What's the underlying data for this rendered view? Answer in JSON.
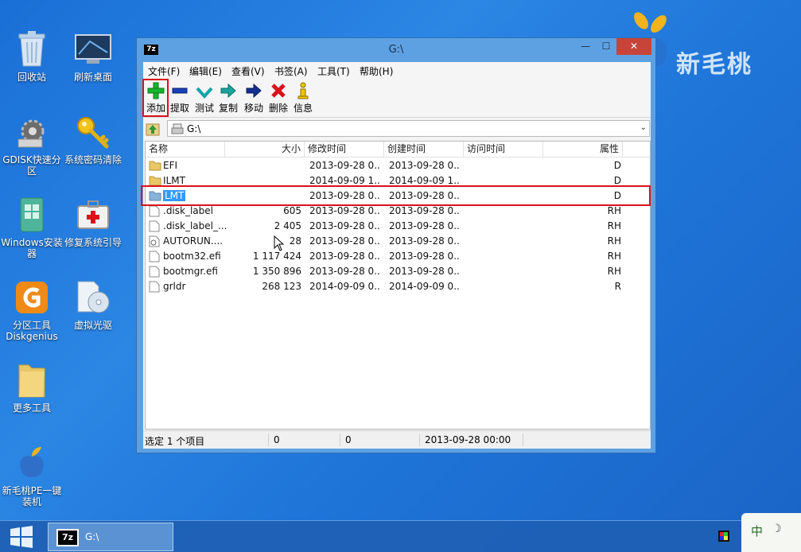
{
  "desktop": {
    "icons": [
      {
        "label": "回收站"
      },
      {
        "label": "刷新桌面"
      },
      {
        "label": "GDISK快速分区"
      },
      {
        "label": "系统密码清除"
      },
      {
        "label": "Windows安装器"
      },
      {
        "label": "修复系统引导"
      },
      {
        "label": "分区工具Diskgenius"
      },
      {
        "label": "虚拟光驱"
      },
      {
        "label": "更多工具"
      },
      {
        "label": "新毛桃PE一键装机"
      }
    ],
    "brand_text": "新毛桃"
  },
  "window": {
    "app_icon": "7z",
    "title": "G:\\",
    "controls": {
      "minimize": "—",
      "maximize": "☐",
      "close": "✕"
    }
  },
  "menu": [
    "文件(F)",
    "编辑(E)",
    "查看(V)",
    "书签(A)",
    "工具(T)",
    "帮助(H)"
  ],
  "toolbar": {
    "add": "添加",
    "extract": "提取",
    "test": "测试",
    "copy": "复制",
    "move": "移动",
    "delete": "删除",
    "info": "信息"
  },
  "address": {
    "path": "G:\\"
  },
  "columns": {
    "name": "名称",
    "size": "大小",
    "modified": "修改时间",
    "created": "创建时间",
    "accessed": "访问时间",
    "attributes": "属性"
  },
  "files": [
    {
      "name": "EFI",
      "size": "",
      "modified": "2013-09-28 0...",
      "created": "2013-09-28 0...",
      "attr": "D",
      "type": "folder"
    },
    {
      "name": "ILMT",
      "size": "",
      "modified": "2014-09-09 1...",
      "created": "2014-09-09 1...",
      "attr": "D",
      "type": "folder"
    },
    {
      "name": "LMT",
      "size": "",
      "modified": "2013-09-28 0...",
      "created": "2013-09-28 0...",
      "attr": "D",
      "type": "folder"
    },
    {
      "name": ".disk_label",
      "size": "605",
      "modified": "2013-09-28 0...",
      "created": "2013-09-28 0...",
      "attr": "RH",
      "type": "file"
    },
    {
      "name": ".disk_label_...",
      "size": "2 405",
      "modified": "2013-09-28 0...",
      "created": "2013-09-28 0...",
      "attr": "RH",
      "type": "file"
    },
    {
      "name": "AUTORUN....",
      "size": "28",
      "modified": "2013-09-28 0...",
      "created": "2013-09-28 0...",
      "attr": "RH",
      "type": "config"
    },
    {
      "name": "bootm32.efi",
      "size": "1 117 424",
      "modified": "2013-09-28 0...",
      "created": "2013-09-28 0...",
      "attr": "RH",
      "type": "file"
    },
    {
      "name": "bootmgr.efi",
      "size": "1 350 896",
      "modified": "2013-09-28 0...",
      "created": "2013-09-28 0...",
      "attr": "RH",
      "type": "file"
    },
    {
      "name": "grldr",
      "size": "268 123",
      "modified": "2014-09-09 0...",
      "created": "2014-09-09 0...",
      "attr": "R",
      "type": "file"
    }
  ],
  "status": {
    "selection": "选定 1 个项目",
    "size": "0",
    "packed": "0",
    "date": "2013-09-28 00:00"
  },
  "taskbar": {
    "task_icon": "7z",
    "task_label": "G:\\"
  },
  "ime": {
    "label": "中"
  },
  "colors": {
    "highlight_red": "#d9121c",
    "selection_blue": "#3399ff",
    "desktop_blue": "#2b86e4"
  }
}
